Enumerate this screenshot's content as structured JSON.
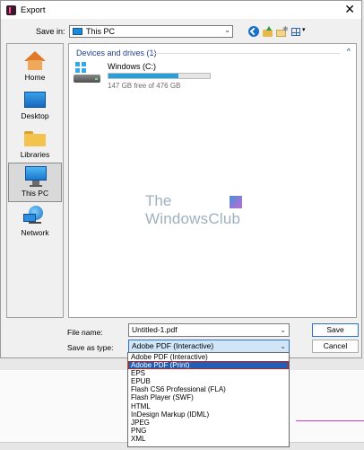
{
  "window": {
    "title": "Export",
    "close_glyph": "✕"
  },
  "save_in": {
    "label": "Save in:",
    "value": "This PC",
    "arrow": "⌄"
  },
  "toolbar": {
    "back_icon": "back-arrow-icon",
    "up_icon": "up-folder-icon",
    "new_folder_icon": "new-folder-icon",
    "view_icon": "view-menu-icon",
    "view_caret": "▾"
  },
  "places": [
    {
      "label": "Home",
      "icon": "home-icon"
    },
    {
      "label": "Desktop",
      "icon": "desktop-icon"
    },
    {
      "label": "Libraries",
      "icon": "libraries-folder-icon"
    },
    {
      "label": "This PC",
      "icon": "this-pc-icon",
      "selected": true
    },
    {
      "label": "Network",
      "icon": "network-icon"
    }
  ],
  "filelist": {
    "group_header": "Devices and drives (1)",
    "group_chevron": "^",
    "drives": [
      {
        "name": "Windows (C:)",
        "info": "147 GB free of 476 GB",
        "used_fraction": 0.69
      }
    ]
  },
  "watermark": {
    "line1": "The",
    "line2": "WindowsClub"
  },
  "form": {
    "file_name_label": "File name:",
    "file_name_value": "Untitled-1.pdf",
    "save_type_label": "Save as type:",
    "save_type_value": "Adobe PDF (Interactive)",
    "arrow": "⌄",
    "save_button": "Save",
    "cancel_button": "Cancel"
  },
  "dropdown": {
    "options": [
      "Adobe PDF (Interactive)",
      "Adobe PDF (Print)",
      "EPS",
      "EPUB",
      "Flash CS6 Professional (FLA)",
      "Flash Player (SWF)",
      "HTML",
      "InDesign Markup (IDML)",
      "JPEG",
      "PNG",
      "XML"
    ],
    "highlighted_index": 1
  },
  "colors": {
    "accent": "#2a73c8",
    "selection": "#1f5fb8",
    "drive_bar": "#26a0da",
    "group_header": "#1e3f8c"
  }
}
